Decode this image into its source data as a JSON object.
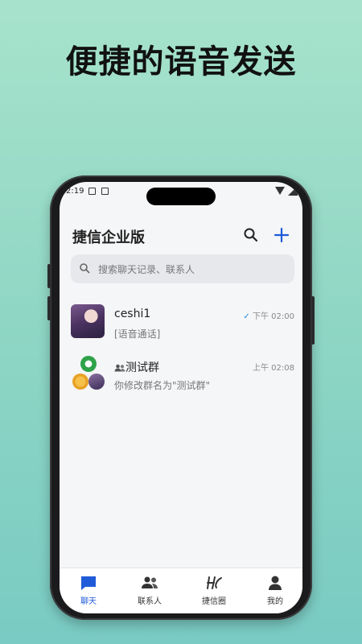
{
  "promo": {
    "headline": "便捷的语音发送"
  },
  "status_bar": {
    "time": "2:19"
  },
  "header": {
    "title": "捷信企业版"
  },
  "search": {
    "placeholder": "搜索聊天记录、联系人"
  },
  "conversations": [
    {
      "name": "ceshi1",
      "last_message": "[语音通话]",
      "time": "下午 02:00",
      "read": true
    },
    {
      "name": "测试群",
      "last_message": "你修改群名为\"测试群\"",
      "time": "上午 02:08",
      "is_group": true
    }
  ],
  "tabs": [
    {
      "label": "聊天",
      "icon": "chat-bubble-icon",
      "active": true
    },
    {
      "label": "联系人",
      "icon": "contacts-icon",
      "active": false
    },
    {
      "label": "捷信圈",
      "icon": "moments-icon",
      "active": false
    },
    {
      "label": "我的",
      "icon": "profile-icon",
      "active": false
    }
  ],
  "colors": {
    "accent": "#1f5bd8",
    "bg_top": "#a7e3cc",
    "bg_bottom": "#79cbc3",
    "check": "#1f8ad8"
  }
}
